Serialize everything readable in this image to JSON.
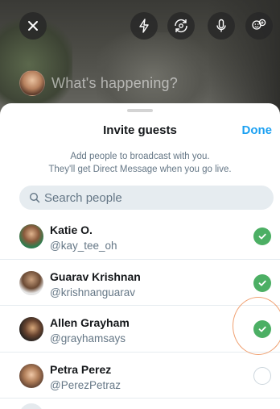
{
  "camera": {
    "compose_placeholder": "What's happening?",
    "buttons": [
      {
        "name": "close",
        "icon": "close-icon"
      },
      {
        "name": "flash",
        "icon": "flash-icon"
      },
      {
        "name": "flip-camera",
        "icon": "flip-camera-icon"
      },
      {
        "name": "microphone",
        "icon": "microphone-icon"
      },
      {
        "name": "invite-guests",
        "icon": "add-guests-icon"
      }
    ]
  },
  "sheet": {
    "title": "Invite guests",
    "done_label": "Done",
    "subtitle_line1": "Add people to broadcast with you.",
    "subtitle_line2": "They'll get Direct Message when you go live.",
    "search_placeholder": "Search people"
  },
  "guests": [
    {
      "name": "Katie O.",
      "handle": "@kay_tee_oh",
      "selected": true
    },
    {
      "name": "Guarav Krishnan",
      "handle": "@krishnanguarav",
      "selected": true
    },
    {
      "name": "Allen Grayham",
      "handle": "@grayhamsays",
      "selected": true
    },
    {
      "name": "Petra Perez",
      "handle": "@PerezPetraz",
      "selected": false
    }
  ],
  "colors": {
    "accent": "#1da1f2",
    "selected_check": "#4caf64",
    "highlight_ring": "#f0a070"
  }
}
